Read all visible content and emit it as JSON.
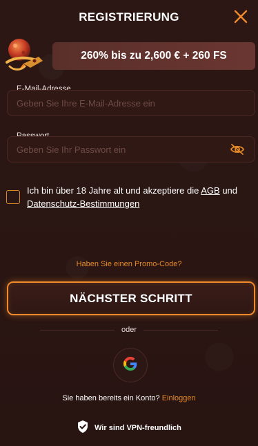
{
  "header": {
    "title": "REGISTRIERUNG",
    "close_icon": "close-icon"
  },
  "promo": {
    "text": "260% bis zu 2,600 € + 260 FS",
    "image_icon": "rocket-planet-icon"
  },
  "email": {
    "label": "E-Mail-Adresse",
    "placeholder": "Geben Sie Ihre E-Mail-Adresse ein",
    "value": ""
  },
  "password": {
    "label": "Passwort",
    "placeholder": "Geben Sie Ihr Passwort ein",
    "value": "",
    "toggle_icon": "eye-off-icon"
  },
  "terms": {
    "checked": false,
    "text_before": "Ich bin über 18 Jahre alt und akzeptiere die ",
    "link_agb": "AGB",
    "text_and": " und ",
    "link_privacy": "Datenschutz-Bestimmungen"
  },
  "promo_code_link": "Haben Sie einen Promo-Code?",
  "next_button": "NÄCHSTER SCHRITT",
  "divider_text": "oder",
  "google_icon": "google-icon",
  "login": {
    "text": "Sie haben bereits ein Konto? ",
    "link": "Einloggen"
  },
  "vpn": {
    "text": "Wir sind VPN-freundlich",
    "icon": "shield-check-icon"
  },
  "colors": {
    "background": "#2a1512",
    "accent": "#e58a26",
    "banner": "#5a2f2a",
    "input_bg": "#301915"
  }
}
